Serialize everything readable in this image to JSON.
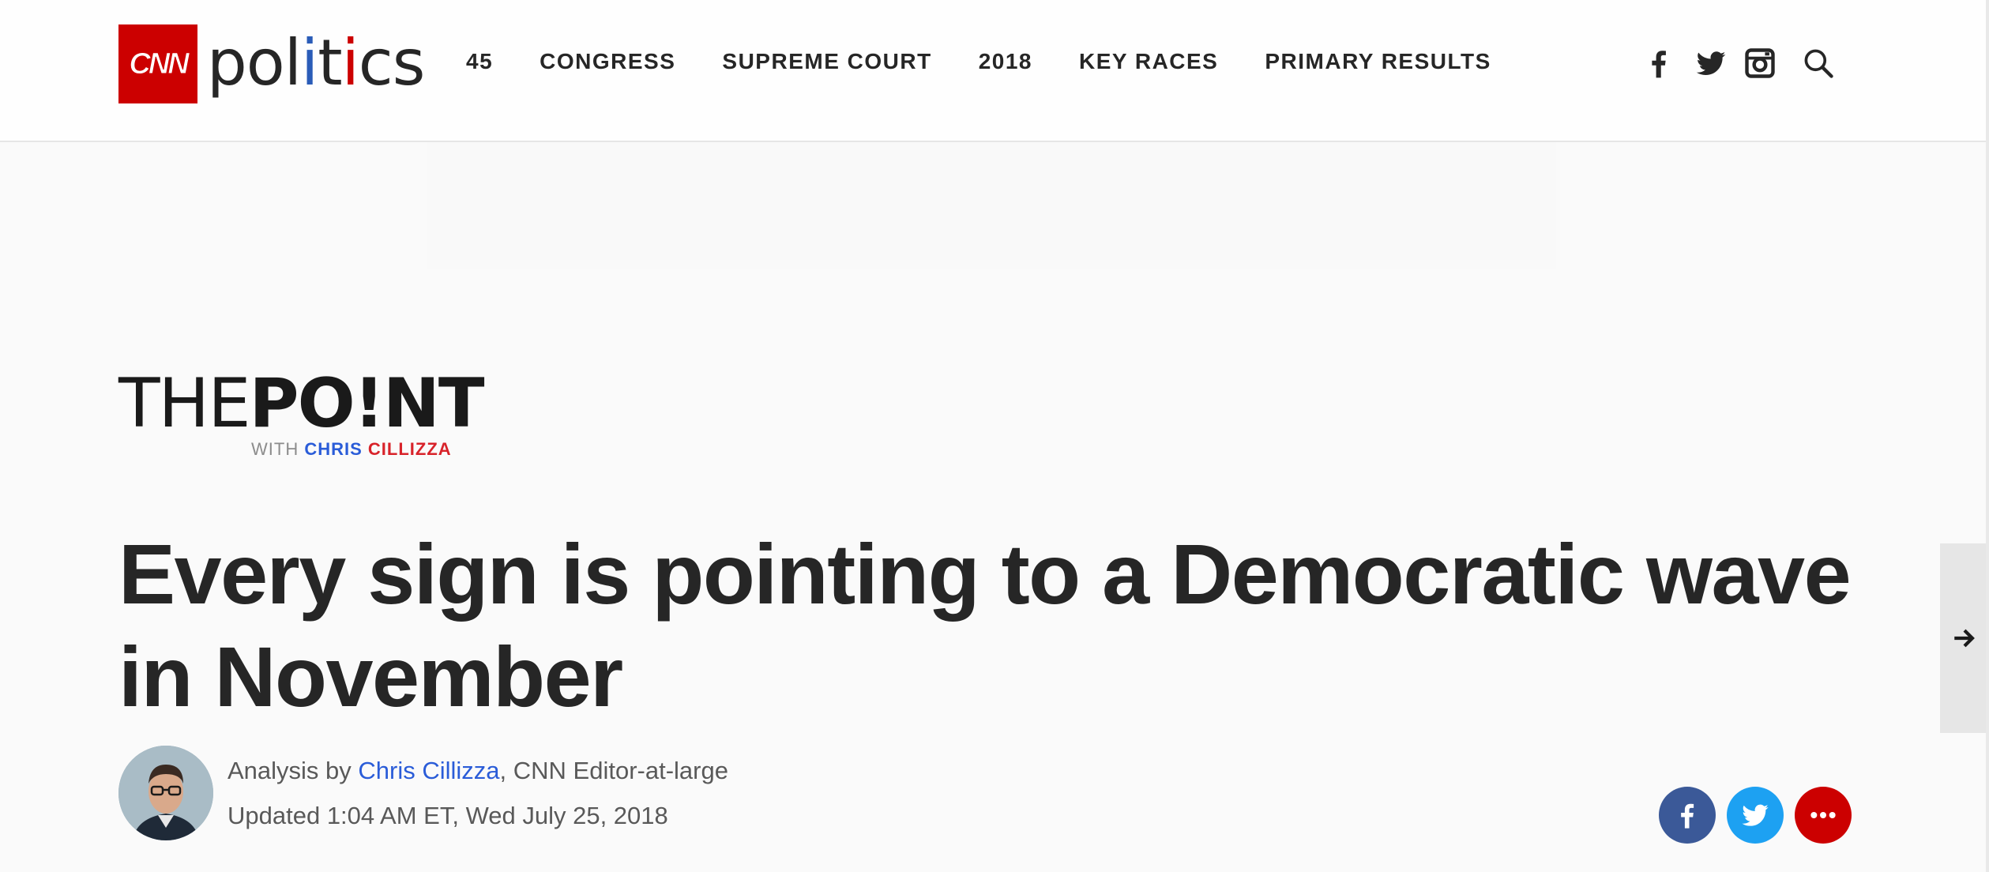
{
  "header": {
    "logo_brand": "CNN",
    "logo_section_parts": [
      "pol",
      "i",
      "t",
      "i",
      "cs"
    ],
    "nav": [
      "45",
      "CONGRESS",
      "SUPREME COURT",
      "2018",
      "KEY RACES",
      "PRIMARY RESULTS"
    ],
    "social_icons": [
      "facebook-icon",
      "twitter-icon",
      "instagram-icon",
      "search-icon"
    ]
  },
  "column": {
    "the": "THE",
    "point": "PO!NT",
    "with": "WITH ",
    "chris": "CHRIS ",
    "cillizza": "CILLIZZA"
  },
  "article": {
    "headline": "Every sign is pointing to a Democratic wave in November",
    "analysis_prefix": "Analysis by ",
    "author": "Chris Cillizza",
    "author_role": ", CNN Editor-at-large",
    "updated": "Updated 1:04 AM ET, Wed July 25, 2018"
  },
  "share": [
    "facebook-share",
    "twitter-share",
    "more-share"
  ],
  "colors": {
    "cnn_red": "#cc0000",
    "facebook": "#3b5998",
    "twitter": "#1da1f2",
    "more": "#cc0000",
    "link_blue": "#2a5cd8"
  }
}
